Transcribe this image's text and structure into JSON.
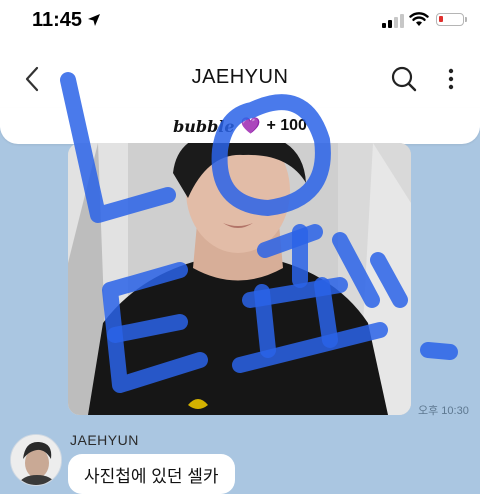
{
  "status_bar": {
    "time": "11:45",
    "icons": [
      "location-arrow-icon",
      "signal-icon",
      "wifi-icon",
      "battery-icon"
    ],
    "battery_color": "#e0302e"
  },
  "nav": {
    "title": "JAEHYUN",
    "back_icon": "chevron-left-icon",
    "search_icon": "search-icon",
    "more_icon": "more-vertical-icon"
  },
  "bubble_bar": {
    "brand": "bubble",
    "heart": "💜",
    "count": "+ 100"
  },
  "chat": {
    "photo_time": "오후 10:30",
    "sender": "JAEHYUN",
    "message": "사진첩에 있던 셀카"
  },
  "colors": {
    "chat_background": "#aac6e1",
    "scribble": "#2a63e8"
  }
}
